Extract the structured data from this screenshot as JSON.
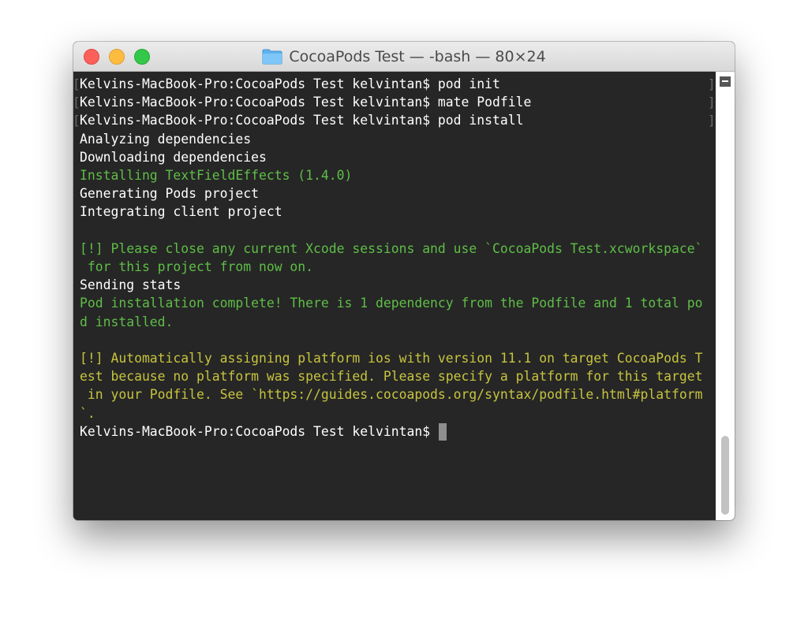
{
  "window": {
    "title": "CocoaPods Test — -bash — 80×24",
    "icon": "folder-icon"
  },
  "terminal": {
    "lines": [
      {
        "text": "Kelvins-MacBook-Pro:CocoaPods Test kelvintan$ pod init",
        "color": "white",
        "marked": true
      },
      {
        "text": "Kelvins-MacBook-Pro:CocoaPods Test kelvintan$ mate Podfile",
        "color": "white",
        "marked": true
      },
      {
        "text": "Kelvins-MacBook-Pro:CocoaPods Test kelvintan$ pod install",
        "color": "white",
        "marked": true
      },
      {
        "text": "Analyzing dependencies",
        "color": "white",
        "marked": false
      },
      {
        "text": "Downloading dependencies",
        "color": "white",
        "marked": false
      },
      {
        "text": "Installing TextFieldEffects (1.4.0)",
        "color": "green",
        "marked": false
      },
      {
        "text": "Generating Pods project",
        "color": "white",
        "marked": false
      },
      {
        "text": "Integrating client project",
        "color": "white",
        "marked": false
      },
      {
        "text": "",
        "color": "white",
        "marked": false
      },
      {
        "text": "[!] Please close any current Xcode sessions and use `CocoaPods Test.xcworkspace`",
        "color": "green",
        "marked": false
      },
      {
        "text": " for this project from now on.",
        "color": "green",
        "marked": false
      },
      {
        "text": "Sending stats",
        "color": "white",
        "marked": false
      },
      {
        "text": "Pod installation complete! There is 1 dependency from the Podfile and 1 total po",
        "color": "green",
        "marked": false
      },
      {
        "text": "d installed.",
        "color": "green",
        "marked": false
      },
      {
        "text": "",
        "color": "white",
        "marked": false
      },
      {
        "text": "[!] Automatically assigning platform ios with version 11.1 on target CocoaPods T",
        "color": "yellow",
        "marked": false
      },
      {
        "text": "est because no platform was specified. Please specify a platform for this target",
        "color": "yellow",
        "marked": false
      },
      {
        "text": " in your Podfile. See `https://guides.cocoapods.org/syntax/podfile.html#platform",
        "color": "yellow",
        "marked": false
      },
      {
        "text": "`.",
        "color": "yellow",
        "marked": false
      },
      {
        "text": "Kelvins-MacBook-Pro:CocoaPods Test kelvintan$ ",
        "color": "white",
        "marked": false
      }
    ]
  },
  "colors": {
    "background": "#262626",
    "text": "#ffffff",
    "green": "#5fbe47",
    "yellow": "#c7c43e",
    "close": "#fc605b",
    "minimize": "#fdbc40",
    "zoom": "#34c84a"
  },
  "scrollbar": {
    "scroll_position": 1.0
  }
}
